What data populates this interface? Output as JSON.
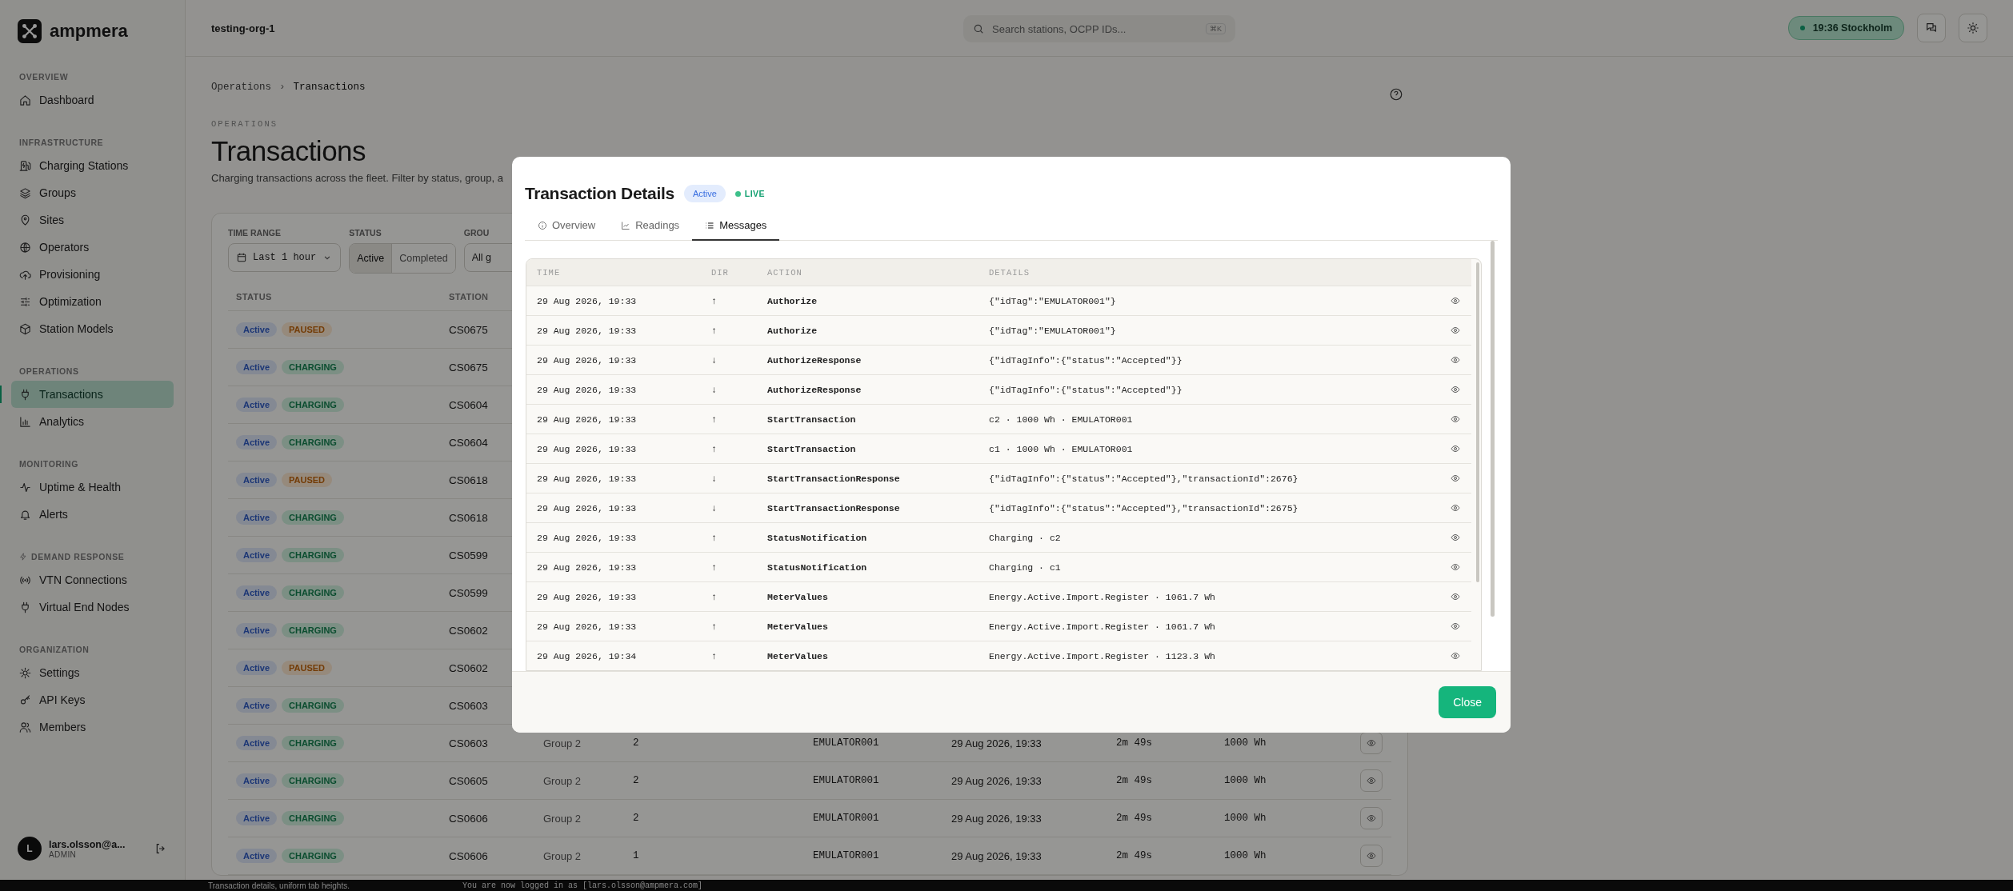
{
  "sidebar": {
    "brand": "ampmera",
    "sections": [
      {
        "title": "OVERVIEW",
        "items": [
          {
            "label": "Dashboard",
            "selected": false
          }
        ]
      },
      {
        "title": "INFRASTRUCTURE",
        "items": [
          {
            "label": "Charging Stations",
            "selected": false
          },
          {
            "label": "Groups",
            "selected": false
          },
          {
            "label": "Sites",
            "selected": false
          },
          {
            "label": "Operators",
            "selected": false
          },
          {
            "label": "Provisioning",
            "selected": false
          },
          {
            "label": "Optimization",
            "selected": false
          },
          {
            "label": "Station Models",
            "selected": false
          }
        ]
      },
      {
        "title": "OPERATIONS",
        "items": [
          {
            "label": "Transactions",
            "selected": true
          },
          {
            "label": "Analytics",
            "selected": false
          }
        ]
      },
      {
        "title": "MONITORING",
        "items": [
          {
            "label": "Uptime & Health",
            "selected": false
          },
          {
            "label": "Alerts",
            "selected": false
          }
        ]
      },
      {
        "title": "DEMAND RESPONSE",
        "items": [
          {
            "label": "VTN Connections",
            "selected": false
          },
          {
            "label": "Virtual End Nodes",
            "selected": false
          }
        ]
      },
      {
        "title": "ORGANIZATION",
        "items": [
          {
            "label": "Settings",
            "selected": false
          },
          {
            "label": "API Keys",
            "selected": false
          },
          {
            "label": "Members",
            "selected": false
          }
        ]
      }
    ],
    "user": {
      "initial": "L",
      "name": "lars.olsson@a...",
      "role": "ADMIN"
    }
  },
  "topbar": {
    "org": "testing-org-1",
    "search": {
      "placeholder": "Search stations, OCPP IDs...",
      "shortcut": "⌘K"
    },
    "clock": "19:36 Stockholm"
  },
  "breadcrumb": {
    "items": [
      "Operations",
      "Transactions"
    ],
    "separator": "›"
  },
  "page": {
    "eyebrow": "OPERATIONS",
    "title": "Transactions",
    "description": "Charging transactions across the fleet. Filter by status, group, a"
  },
  "filters": {
    "time_range": {
      "label": "TIME RANGE",
      "value": "Last 1 hour"
    },
    "status": {
      "label": "STATUS",
      "options": [
        {
          "label": "Active",
          "selected": true
        },
        {
          "label": "Completed",
          "selected": false
        }
      ]
    },
    "group": {
      "label": "GROU",
      "value": "All g"
    }
  },
  "table": {
    "columns": [
      "STATUS",
      "STATION"
    ],
    "rows": [
      {
        "status": "Active",
        "state": "PAUSED",
        "kind": "paused",
        "station": "CS0675"
      },
      {
        "status": "Active",
        "state": "CHARGING",
        "kind": "charging",
        "station": "CS0675"
      },
      {
        "status": "Active",
        "state": "CHARGING",
        "kind": "charging",
        "station": "CS0604"
      },
      {
        "status": "Active",
        "state": "CHARGING",
        "kind": "charging",
        "station": "CS0604"
      },
      {
        "status": "Active",
        "state": "PAUSED",
        "kind": "paused",
        "station": "CS0618"
      },
      {
        "status": "Active",
        "state": "CHARGING",
        "kind": "charging",
        "station": "CS0618"
      },
      {
        "status": "Active",
        "state": "CHARGING",
        "kind": "charging",
        "station": "CS0599"
      },
      {
        "status": "Active",
        "state": "CHARGING",
        "kind": "charging",
        "station": "CS0599"
      },
      {
        "status": "Active",
        "state": "CHARGING",
        "kind": "charging",
        "station": "CS0602"
      },
      {
        "status": "Active",
        "state": "PAUSED",
        "kind": "paused",
        "station": "CS0602"
      },
      {
        "status": "Active",
        "state": "CHARGING",
        "kind": "charging",
        "station": "CS0603"
      },
      {
        "status": "Active",
        "state": "CHARGING",
        "kind": "charging",
        "station": "CS0603",
        "cells": [
          "Group 2",
          "2",
          "EMULATOR001",
          "29 Aug 2026, 19:33",
          "2m 49s",
          "1000 Wh"
        ]
      },
      {
        "status": "Active",
        "state": "CHARGING",
        "kind": "charging",
        "station": "CS0605",
        "cells": [
          "Group 2",
          "2",
          "EMULATOR001",
          "29 Aug 2026, 19:33",
          "2m 49s",
          "1000 Wh"
        ]
      },
      {
        "status": "Active",
        "state": "CHARGING",
        "kind": "charging",
        "station": "CS0606",
        "cells": [
          "Group 2",
          "2",
          "EMULATOR001",
          "29 Aug 2026, 19:33",
          "2m 49s",
          "1000 Wh"
        ]
      },
      {
        "status": "Active",
        "state": "CHARGING",
        "kind": "charging",
        "station": "CS0606",
        "cells": [
          "Group 2",
          "1",
          "EMULATOR001",
          "29 Aug 2026, 19:33",
          "2m 49s",
          "1000 Wh"
        ]
      }
    ]
  },
  "modal": {
    "title": "Transaction Details",
    "status": "Active",
    "live": "LIVE",
    "tabs": [
      {
        "label": "Overview",
        "selected": false
      },
      {
        "label": "Readings",
        "selected": false
      },
      {
        "label": "Messages",
        "selected": true
      }
    ],
    "columns": [
      "TIME",
      "DIR",
      "ACTION",
      "DETAILS"
    ],
    "messages": [
      {
        "time": "29 Aug 2026, 19:33",
        "dir": "↑",
        "action": "Authorize",
        "details": "{\"idTag\":\"EMULATOR001\"}"
      },
      {
        "time": "29 Aug 2026, 19:33",
        "dir": "↑",
        "action": "Authorize",
        "details": "{\"idTag\":\"EMULATOR001\"}"
      },
      {
        "time": "29 Aug 2026, 19:33",
        "dir": "↓",
        "action": "AuthorizeResponse",
        "details": "{\"idTagInfo\":{\"status\":\"Accepted\"}}"
      },
      {
        "time": "29 Aug 2026, 19:33",
        "dir": "↓",
        "action": "AuthorizeResponse",
        "details": "{\"idTagInfo\":{\"status\":\"Accepted\"}}"
      },
      {
        "time": "29 Aug 2026, 19:33",
        "dir": "↑",
        "action": "StartTransaction",
        "details": "c2 · 1000 Wh · EMULATOR001"
      },
      {
        "time": "29 Aug 2026, 19:33",
        "dir": "↑",
        "action": "StartTransaction",
        "details": "c1 · 1000 Wh · EMULATOR001"
      },
      {
        "time": "29 Aug 2026, 19:33",
        "dir": "↓",
        "action": "StartTransactionResponse",
        "details": "{\"idTagInfo\":{\"status\":\"Accepted\"},\"transactionId\":2676}"
      },
      {
        "time": "29 Aug 2026, 19:33",
        "dir": "↓",
        "action": "StartTransactionResponse",
        "details": "{\"idTagInfo\":{\"status\":\"Accepted\"},\"transactionId\":2675}"
      },
      {
        "time": "29 Aug 2026, 19:33",
        "dir": "↑",
        "action": "StatusNotification",
        "details": "Charging · c2"
      },
      {
        "time": "29 Aug 2026, 19:33",
        "dir": "↑",
        "action": "StatusNotification",
        "details": "Charging · c1"
      },
      {
        "time": "29 Aug 2026, 19:33",
        "dir": "↑",
        "action": "MeterValues",
        "details": "Energy.Active.Import.Register · 1061.7 Wh"
      },
      {
        "time": "29 Aug 2026, 19:33",
        "dir": "↑",
        "action": "MeterValues",
        "details": "Energy.Active.Import.Register · 1061.7 Wh"
      },
      {
        "time": "29 Aug 2026, 19:34",
        "dir": "↑",
        "action": "MeterValues",
        "details": "Energy.Active.Import.Register · 1123.3 Wh"
      }
    ],
    "close": "Close"
  },
  "terminal_strip": [
    "Transaction details, uniform tab heights.",
    "You are now logged in as [lars.olsson@ampmera.com]"
  ]
}
